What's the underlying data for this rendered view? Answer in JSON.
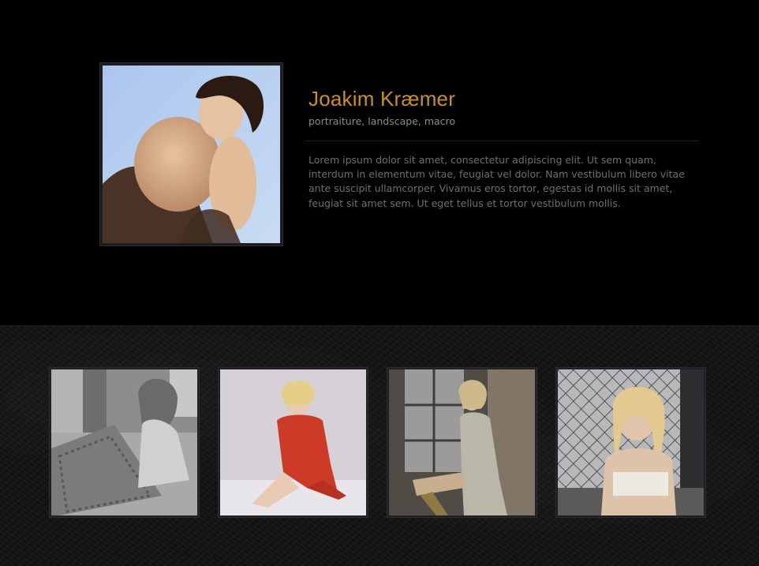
{
  "profile": {
    "name": "Joakim Kræmer",
    "tags": "portraiture, landscape, macro",
    "bio": "Lorem ipsum dolor sit amet, consectetur adipiscing elit. Ut sem quam, interdum in elementum vitae, feugiat vel dolor. Nam vestibulum libero vitae ante suscipit ullamcorper. Vivamus eros tortor, egestas id mollis sit amet, feugiat sit amet sem. Ut eget tellus et tortor vestibulum mollis."
  },
  "colors": {
    "accent": "#c98f2c",
    "background": "#000000",
    "text_muted": "#6f6f6f"
  },
  "gallery": {
    "thumbnails": [
      {
        "icon": "photo-portrait-sofa"
      },
      {
        "icon": "photo-portrait-red-dress"
      },
      {
        "icon": "photo-portrait-window"
      },
      {
        "icon": "photo-portrait-fence"
      }
    ]
  }
}
